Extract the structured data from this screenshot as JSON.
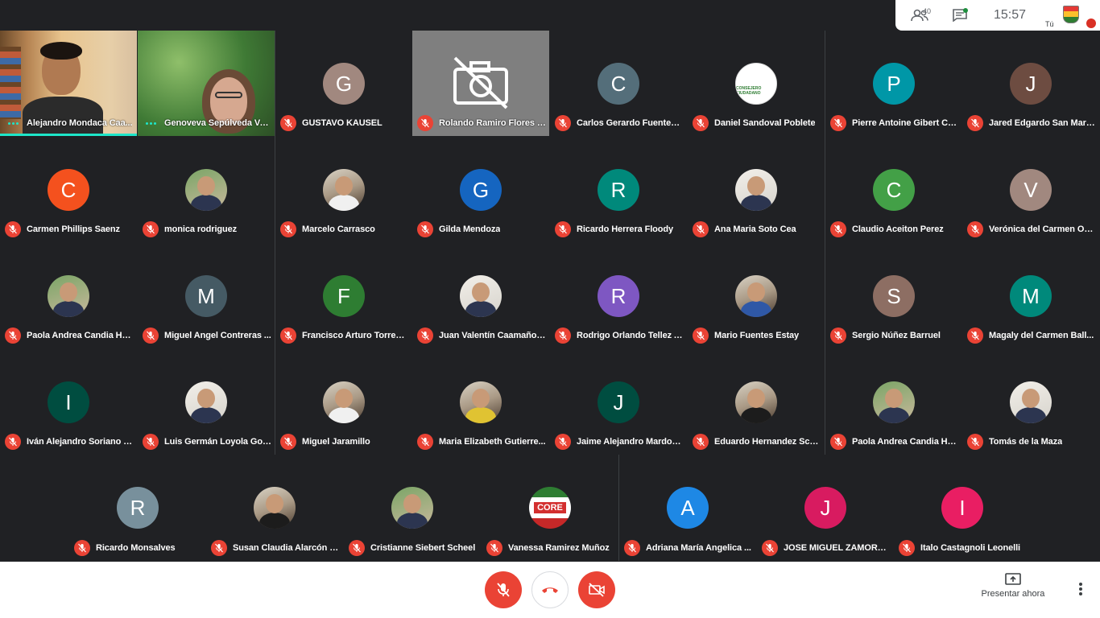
{
  "top_bar": {
    "participant_count": "40",
    "time": "15:57",
    "self_label": "Tú",
    "icons": {
      "people": "people-icon",
      "chat": "chat-icon"
    }
  },
  "tiles": [
    {
      "name": "Alejandro Mondaca Caa...",
      "type": "video",
      "video": "alejandro",
      "speaking": true
    },
    {
      "name": "Genoveva Sepúlveda Ve...",
      "type": "video",
      "video": "genoveva",
      "speaking": true
    },
    {
      "name": "GUSTAVO KAUSEL",
      "initial": "G",
      "color": "#a1887f"
    },
    {
      "name": "Rolando Ramiro Flores F...",
      "type": "video",
      "video": "rolando"
    },
    {
      "name": "Carlos Gerardo Fuentes ...",
      "initial": "C",
      "color": "#546e7a"
    },
    {
      "name": "Daniel Sandoval Poblete",
      "logo": "daniel",
      "logo_text": "DANIEL SANDOVAL",
      "logo_sub": "CONSEJERO CIUDADANO"
    },
    {
      "name": "Pierre Antoine Gibert Col...",
      "initial": "P",
      "color": "#0097a7"
    },
    {
      "name": "Jared Edgardo San Mart...",
      "initial": "J",
      "color": "#6d4c41"
    },
    {
      "name": "Carmen Phillips Saenz",
      "initial": "C",
      "color": "#f4511e"
    },
    {
      "name": "monica rodriguez",
      "photo": "green-bg"
    },
    {
      "name": "Marcelo Carrasco",
      "photo": "white"
    },
    {
      "name": "Gilda Mendoza",
      "initial": "G",
      "color": "#1565c0"
    },
    {
      "name": "Ricardo Herrera Floody",
      "initial": "R",
      "color": "#00897b"
    },
    {
      "name": "Ana Maria Soto Cea",
      "photo": "light"
    },
    {
      "name": "Claudio Aceiton Perez",
      "initial": "C",
      "color": "#43a047"
    },
    {
      "name": "Verónica del Carmen Ort...",
      "initial": "V",
      "color": "#a1887f"
    },
    {
      "name": "Paola Andrea Candia Hu...",
      "photo": "green-bg"
    },
    {
      "name": "Miguel Angel Contreras ...",
      "initial": "M",
      "color": "#455a64"
    },
    {
      "name": "Francisco Arturo Torres ...",
      "initial": "F",
      "color": "#2e7d32"
    },
    {
      "name": "Juan Valentín Caamaño ...",
      "photo": "light"
    },
    {
      "name": "Rodrigo Orlando Tellez A...",
      "initial": "R",
      "color": "#7e57c2"
    },
    {
      "name": "Mario Fuentes Estay",
      "photo": "blue-shirt"
    },
    {
      "name": "Sergio Núñez Barruel",
      "initial": "S",
      "color": "#8d6e63"
    },
    {
      "name": "Magaly del Carmen Ball...",
      "initial": "M",
      "color": "#00897b"
    },
    {
      "name": "Iván Alejandro Soriano T...",
      "initial": "I",
      "color": "#004d40"
    },
    {
      "name": "Luis Germán Loyola Gon...",
      "photo": "light"
    },
    {
      "name": "Miguel Jaramillo",
      "photo": "white"
    },
    {
      "name": "Maria Elizabeth Gutierre...",
      "photo": "yellow"
    },
    {
      "name": "Jaime Alejandro Mardon...",
      "initial": "J",
      "color": "#004d40"
    },
    {
      "name": "Eduardo Hernandez Sch...",
      "photo": "dark"
    },
    {
      "name": "Paola Andrea Candia Hu...",
      "photo": "green-bg"
    },
    {
      "name": "Tomás de la Maza",
      "photo": "light"
    },
    {
      "name": "Ricardo Monsalves",
      "initial": "R",
      "color": "#78909c"
    },
    {
      "name": "Susan Claudia Alarcón R...",
      "photo": "dark"
    },
    {
      "name": "Cristianne Siebert Scheel",
      "photo": "green-bg"
    },
    {
      "name": "Vanessa Ramirez Muñoz",
      "logo": "core",
      "logo_text": "CORE"
    },
    {
      "name": "Adriana María Angelica ...",
      "initial": "A",
      "color": "#1e88e5"
    },
    {
      "name": "JOSE MIGUEL ZAMORA ...",
      "initial": "J",
      "color": "#d81b60"
    },
    {
      "name": "Italo Castagnoli Leonelli",
      "initial": "I",
      "color": "#e91e63"
    }
  ],
  "bottom_bar": {
    "mic_button": "mic-off-icon",
    "hangup_button": "phone-hangup-icon",
    "camera_button": "camera-off-icon",
    "present_label": "Presentar ahora",
    "more_button": "more-vert-icon"
  },
  "colors": {
    "muted_red": "#ea4335",
    "speaking_teal": "#1ee6c9",
    "background": "#202124"
  }
}
